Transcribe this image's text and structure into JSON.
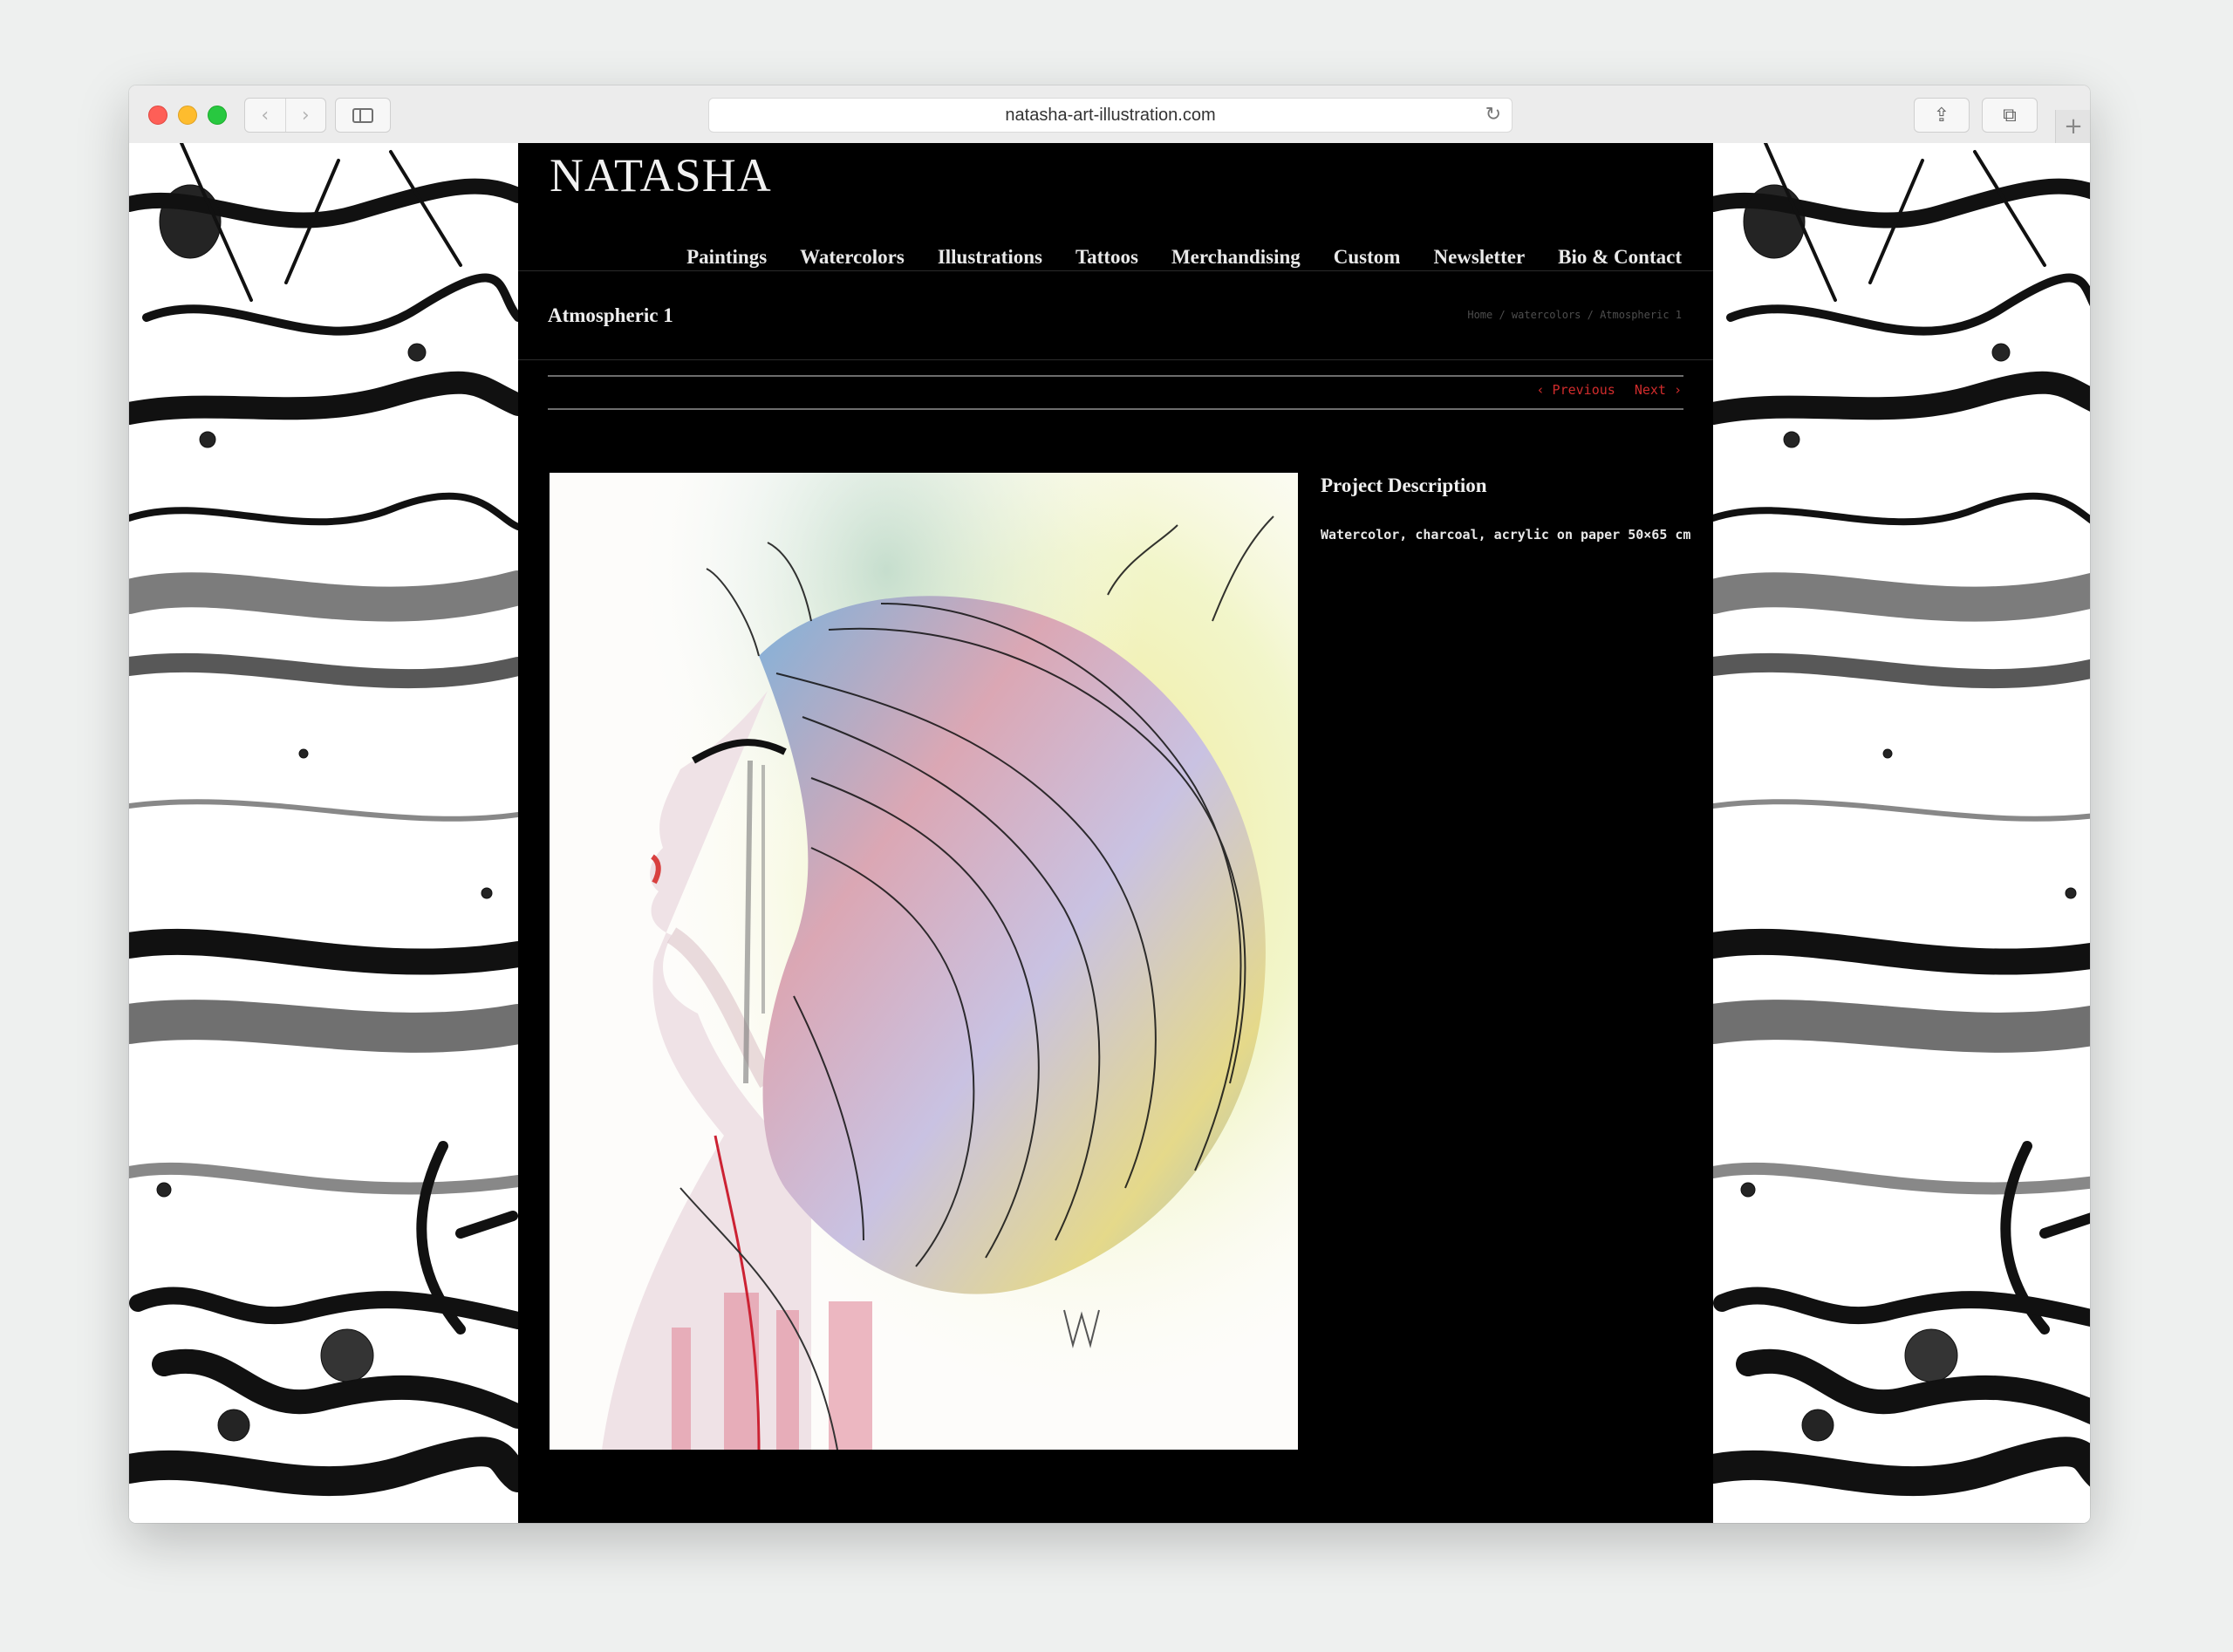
{
  "browser": {
    "url": "natasha-art-illustration.com",
    "back_glyph": "‹",
    "forward_glyph": "›",
    "reload_glyph": "↻",
    "share_glyph": "⇪",
    "tabs_glyph": "⧉",
    "newtab_glyph": "+"
  },
  "site": {
    "logo": "NATASHA",
    "nav": [
      "Paintings",
      "Watercolors",
      "Illustrations",
      "Tattoos",
      "Merchandising",
      "Custom",
      "Newsletter",
      "Bio & Contact"
    ],
    "page_title": "Atmospheric 1",
    "breadcrumb": "Home / watercolors / Atmospheric 1",
    "previous_label": "‹ Previous",
    "next_label": "Next ›",
    "description_title": "Project Description",
    "description_text": "Watercolor, charcoal, acrylic on paper 50×65 cm"
  },
  "colors": {
    "accent_red": "#d02c2c",
    "site_background": "#000000",
    "page_background": "#ffffff"
  }
}
